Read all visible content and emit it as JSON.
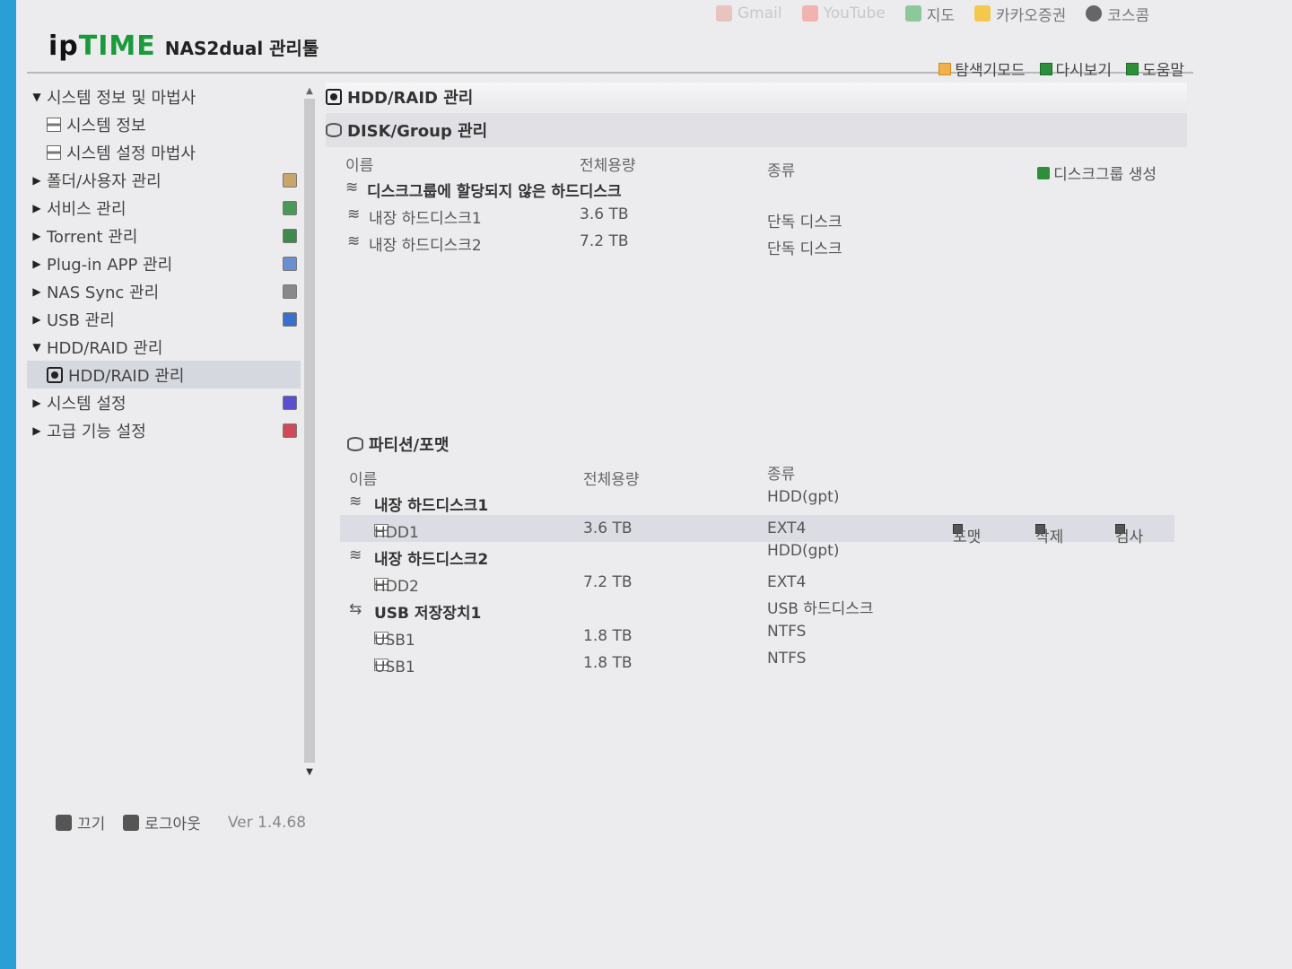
{
  "bookmarks": [
    {
      "label": "Gmail",
      "faded": true,
      "color": "#d44638"
    },
    {
      "label": "YouTube",
      "faded": true,
      "color": "#e52d27"
    },
    {
      "label": "지도",
      "faded": false,
      "color": "#34a853"
    },
    {
      "label": "카카오증권",
      "faded": false,
      "color": "#f2b600"
    },
    {
      "label": "코스콤",
      "faded": false,
      "color": "#555555"
    }
  ],
  "header": {
    "brand_prefix": "ip",
    "brand_mid": "TIME",
    "product": "NAS2dual 관리툴",
    "links": [
      {
        "label": "탐색기모드",
        "icon": "explorer-icon"
      },
      {
        "label": "다시보기",
        "icon": "refresh-icon"
      },
      {
        "label": "도움말",
        "icon": "help-icon"
      }
    ]
  },
  "sidebar": {
    "items": [
      {
        "label": "시스템 정보 및 마법사",
        "expanded": true
      },
      {
        "label": "시스템 정보",
        "sub": true
      },
      {
        "label": "시스템 설정 마법사",
        "sub": true
      },
      {
        "label": "폴더/사용자 관리"
      },
      {
        "label": "서비스 관리"
      },
      {
        "label": "Torrent 관리"
      },
      {
        "label": "Plug-in APP 관리"
      },
      {
        "label": "NAS Sync 관리"
      },
      {
        "label": "USB 관리"
      },
      {
        "label": "HDD/RAID 관리",
        "expanded": true
      },
      {
        "label": "HDD/RAID 관리",
        "sub": true,
        "selected": true
      },
      {
        "label": "시스템 설정"
      },
      {
        "label": "고급 기능 설정"
      }
    ]
  },
  "footer": {
    "power": "끄기",
    "logout": "로그아웃",
    "version": "Ver 1.4.68"
  },
  "main": {
    "title": "HDD/RAID 관리",
    "disk_group": {
      "title": "DISK/Group 관리",
      "headers": {
        "name": "이름",
        "capacity": "전체용량",
        "type": "종류"
      },
      "create_label": "디스크그룹 생성",
      "unassigned_label": "디스크그룹에 할당되지 않은 하드디스크",
      "rows": [
        {
          "name": "내장 하드디스크1",
          "capacity": "3.6 TB",
          "type": "단독 디스크"
        },
        {
          "name": "내장 하드디스크2",
          "capacity": "7.2 TB",
          "type": "단독 디스크"
        }
      ]
    },
    "partition": {
      "title": "파티션/포맷",
      "headers": {
        "name": "이름",
        "capacity": "전체용량",
        "type": "종류"
      },
      "actions": {
        "format": "포맷",
        "delete": "삭제",
        "check": "검사"
      },
      "groups": [
        {
          "name": "내장 하드디스크1",
          "type": "HDD(gpt)",
          "parts": [
            {
              "name": "HDD1",
              "capacity": "3.6 TB",
              "type": "EXT4",
              "selected": true
            }
          ]
        },
        {
          "name": "내장 하드디스크2",
          "type": "HDD(gpt)",
          "parts": [
            {
              "name": "HDD2",
              "capacity": "7.2 TB",
              "type": "EXT4"
            }
          ]
        },
        {
          "name": "USB 저장장치1",
          "type": "USB 하드디스크",
          "parts": [
            {
              "name": "USB1",
              "capacity": "1.8 TB",
              "type": "NTFS"
            },
            {
              "name": "USB1",
              "capacity": "1.8 TB",
              "type": "NTFS"
            }
          ]
        }
      ]
    }
  }
}
